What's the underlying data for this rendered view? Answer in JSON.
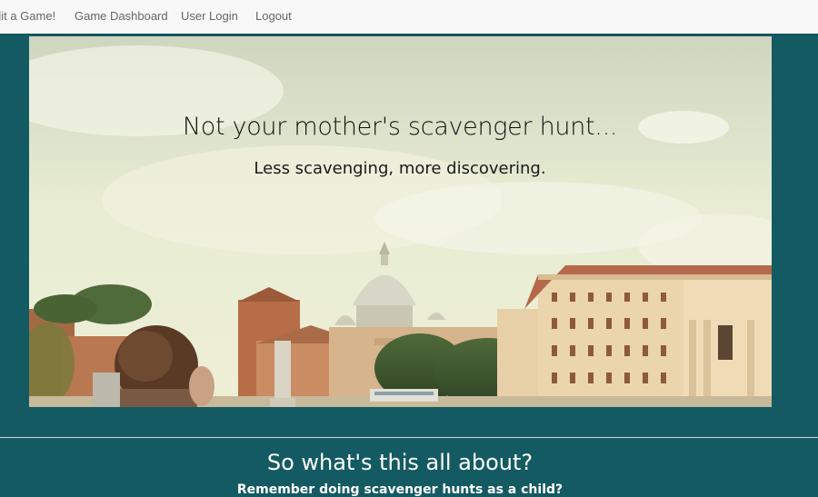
{
  "nav": {
    "items": [
      {
        "label": "dit a Game!"
      },
      {
        "label": "Game Dashboard"
      },
      {
        "label": "User Login"
      },
      {
        "label": "Logout"
      }
    ]
  },
  "hero": {
    "heading": "Not your mother's scavenger hunt...",
    "subheading": "Less scavenging, more discovering."
  },
  "about": {
    "title": "So what's this all about?",
    "text": "Remember doing scavenger hunts as a child?"
  },
  "colors": {
    "page_background": "#145a62",
    "nav_background": "#f8f8f8",
    "nav_text": "#666666"
  }
}
